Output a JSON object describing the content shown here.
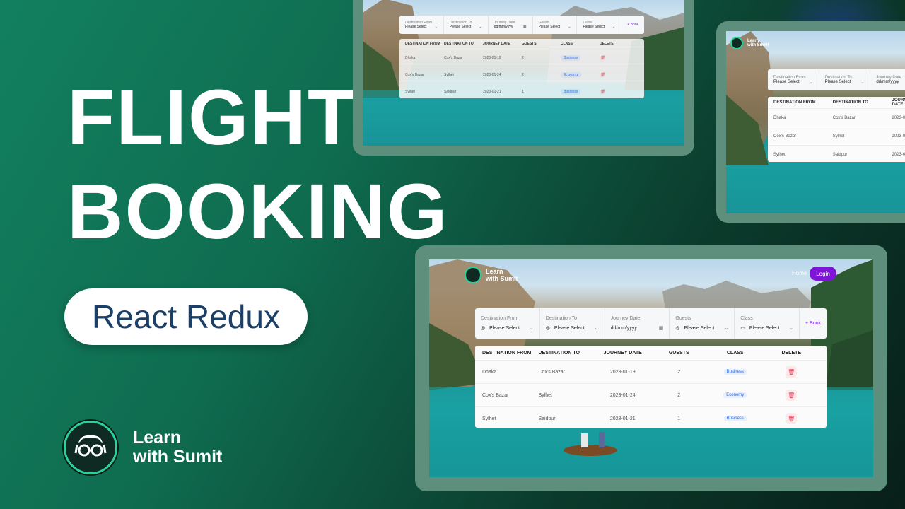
{
  "hero": {
    "title_line1": "FLIGHT",
    "title_line2": "BOOKING",
    "tag": "React Redux"
  },
  "brand": {
    "line1": "Learn",
    "line2": "with Sumit",
    "accent_color": "#2bd19a"
  },
  "app": {
    "nav": {
      "home_label": "Home",
      "login_label": "Login",
      "login_color": "#7d14d6"
    },
    "form": {
      "destination_from_label": "Destination From",
      "destination_to_label": "Destination To",
      "journey_date_label": "Journey Date",
      "guests_label": "Guests",
      "class_label": "Class",
      "select_placeholder": "Please Select",
      "date_placeholder": "dd/mm/yyyy",
      "book_label": "Book"
    },
    "table": {
      "headers": [
        "DESTINATION FROM",
        "DESTINATION TO",
        "JOURNEY DATE",
        "GUESTS",
        "CLASS",
        "DELETE"
      ],
      "rows": [
        {
          "from": "Dhaka",
          "to": "Cox's Bazar",
          "date": "2023-01-19",
          "guests": "2",
          "class": "Business"
        },
        {
          "from": "Cox's Bazar",
          "to": "Sylhet",
          "date": "2023-01-24",
          "guests": "2",
          "class": "Economy"
        },
        {
          "from": "Sylhet",
          "to": "Saidpur",
          "date": "2023-01-21",
          "guests": "1",
          "class": "Business"
        }
      ]
    }
  }
}
